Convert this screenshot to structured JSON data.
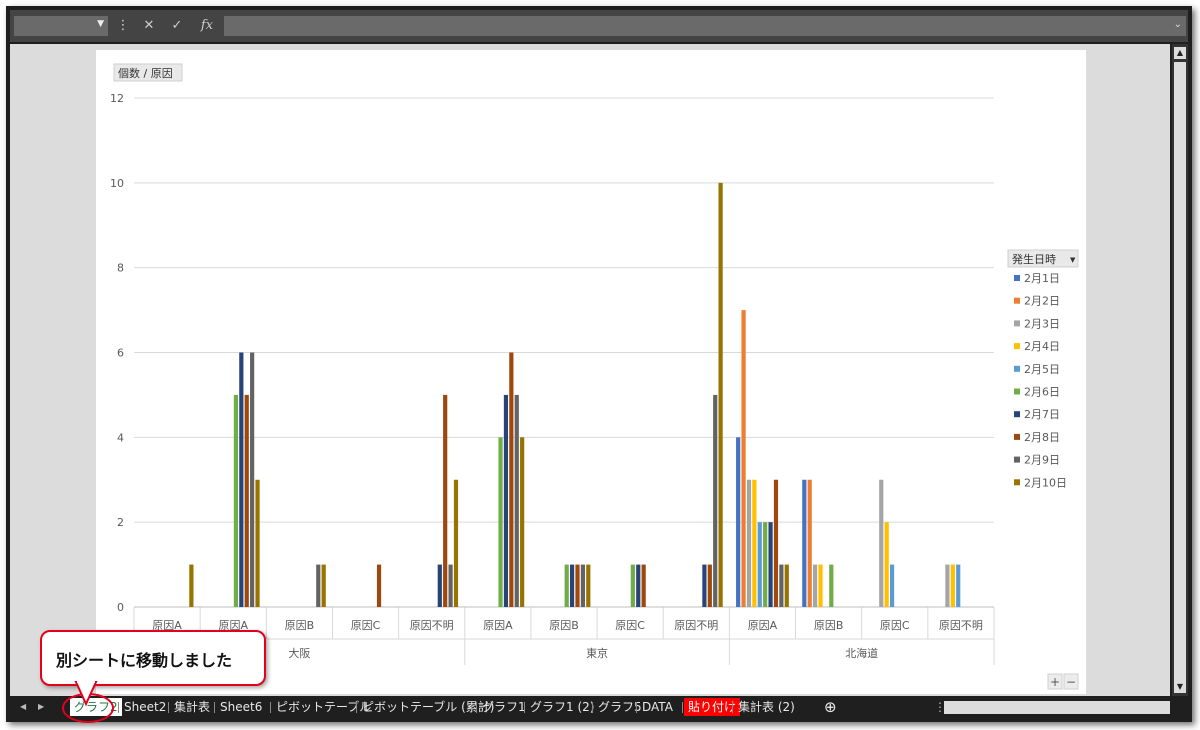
{
  "formula_bar": {
    "name_box": "",
    "cancel_label": "✕",
    "enter_label": "✓",
    "fx_label": "fx",
    "formula": ""
  },
  "chart_data": {
    "type": "bar",
    "field_button": "個数 / 原因",
    "legend_title": "発生日時",
    "ylim": [
      0,
      12
    ],
    "yticks": [
      0,
      2,
      4,
      6,
      8,
      10,
      12
    ],
    "groups": [
      {
        "name": "大阪",
        "categories": [
          "原因A",
          "原因A",
          "原因B",
          "原因C",
          "原因不明"
        ]
      },
      {
        "name": "東京",
        "categories": [
          "原因A",
          "原因B",
          "原因C",
          "原因不明"
        ]
      },
      {
        "name": "北海道",
        "categories": [
          "原因A",
          "原因B",
          "原因C",
          "原因不明"
        ]
      }
    ],
    "series": [
      {
        "name": "2月1日",
        "color": "#4472c4",
        "values": [
          0,
          0,
          0,
          0,
          0,
          0,
          0,
          0,
          0,
          4,
          3,
          0,
          0
        ]
      },
      {
        "name": "2月2日",
        "color": "#ed7d31",
        "values": [
          0,
          0,
          0,
          0,
          0,
          0,
          0,
          0,
          0,
          7,
          3,
          0,
          0
        ]
      },
      {
        "name": "2月3日",
        "color": "#a5a5a5",
        "values": [
          0,
          0,
          0,
          0,
          0,
          0,
          0,
          0,
          0,
          3,
          1,
          3,
          1
        ]
      },
      {
        "name": "2月4日",
        "color": "#ffc000",
        "values": [
          0,
          0,
          0,
          0,
          0,
          0,
          0,
          0,
          0,
          3,
          1,
          2,
          1
        ]
      },
      {
        "name": "2月5日",
        "color": "#5b9bd5",
        "values": [
          0,
          0,
          0,
          0,
          0,
          0,
          0,
          0,
          0,
          2,
          0,
          1,
          1
        ]
      },
      {
        "name": "2月6日",
        "color": "#70ad47",
        "values": [
          0,
          5,
          0,
          0,
          0,
          4,
          1,
          1,
          0,
          2,
          1,
          0,
          0
        ]
      },
      {
        "name": "2月7日",
        "color": "#264478",
        "values": [
          0,
          6,
          0,
          0,
          1,
          5,
          1,
          1,
          1,
          2,
          0,
          0,
          0
        ]
      },
      {
        "name": "2月8日",
        "color": "#9e480e",
        "values": [
          0,
          5,
          0,
          1,
          5,
          6,
          1,
          1,
          1,
          3,
          0,
          0,
          0
        ]
      },
      {
        "name": "2月9日",
        "color": "#636363",
        "values": [
          0,
          6,
          1,
          0,
          1,
          5,
          1,
          0,
          5,
          1,
          0,
          0,
          0
        ]
      },
      {
        "name": "2月10日",
        "color": "#997300",
        "values": [
          1,
          3,
          1,
          0,
          3,
          4,
          1,
          0,
          10,
          1,
          0,
          0,
          0
        ]
      }
    ]
  },
  "chart_controls": {
    "plus": "+",
    "minus": "−"
  },
  "tabs": {
    "items": [
      {
        "label": "グラフ2",
        "active": true
      },
      {
        "label": "Sheet2"
      },
      {
        "label": "集計表"
      },
      {
        "label": "Sheet6"
      },
      {
        "label": "ピボットテーブル"
      },
      {
        "label": "ピボットテーブル (累計)"
      },
      {
        "label": "グラフ1"
      },
      {
        "label": "グラフ1 (2)"
      },
      {
        "label": "グラフ5"
      },
      {
        "label": "DATA"
      },
      {
        "label": "貼り付け",
        "highlight": true
      },
      {
        "label": "集計表 (2)"
      }
    ],
    "add_label": "⊕",
    "prev_label": "◀",
    "next_label": "▶"
  },
  "callout": {
    "text": "別シートに移動しました"
  }
}
